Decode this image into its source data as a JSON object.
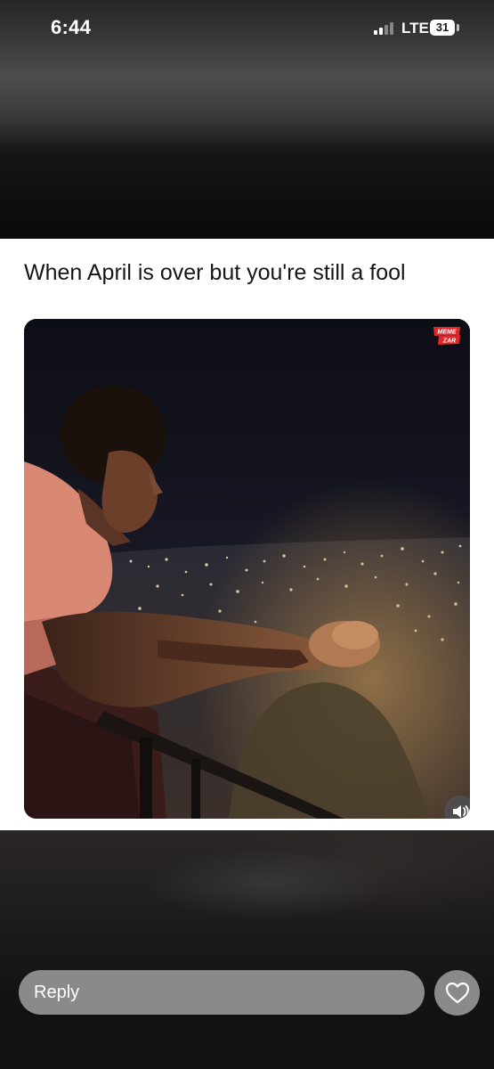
{
  "status_bar": {
    "time": "6:44",
    "network": "LTE",
    "battery": "31",
    "signal_bars_active": 2,
    "signal_bars_total": 4
  },
  "post": {
    "caption": "When April is over but you're still a fool",
    "watermark": "MEMEZAR",
    "image_description_icon": "photo-night-city-overlook"
  },
  "controls": {
    "volume_icon": "speaker-icon",
    "reply_placeholder": "Reply",
    "like_icon": "heart-icon"
  },
  "colors": {
    "card_background": "#ffffff",
    "reply_bar": "#8a8a8a",
    "watermark_red": "#e3262a"
  }
}
